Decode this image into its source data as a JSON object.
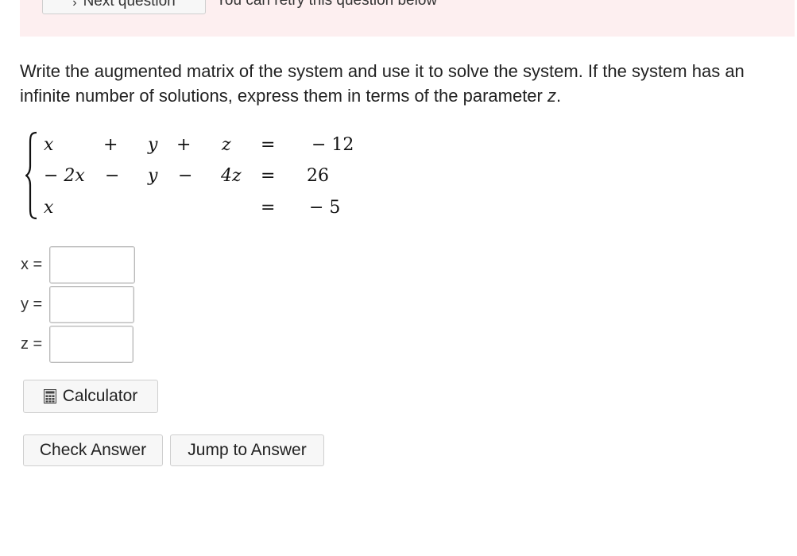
{
  "banner": {
    "next_question_label": "Next question",
    "next_question_icon": "chevron-right-icon",
    "retry_text": "You can retry this question below"
  },
  "question": {
    "text": "Write the augmented matrix of the system and use it to solve the system. If the system has an infinite number of solutions, express them in terms of the parameter ",
    "parameter": "z",
    "end": "."
  },
  "system": {
    "rows": [
      {
        "x": "x",
        "op1": "+",
        "y": "y",
        "op2": "+",
        "z": "z",
        "eq": "=",
        "rhs": "− 12"
      },
      {
        "x": "− 2x",
        "op1": "−",
        "y": "y",
        "op2": "−",
        "z": "4z",
        "eq": "=",
        "rhs": "26"
      },
      {
        "x": "x",
        "op1": "",
        "y": "",
        "op2": "",
        "z": "",
        "eq": "=",
        "rhs": "− 5"
      }
    ]
  },
  "answers": {
    "x_label": "x =",
    "y_label": "y =",
    "z_label": "z =",
    "x_value": "",
    "y_value": "",
    "z_value": ""
  },
  "buttons": {
    "calculator": "Calculator",
    "calculator_icon": "calculator-icon",
    "check_answer": "Check Answer",
    "jump_to_answer": "Jump to Answer"
  },
  "colors": {
    "banner_bg": "#fdeff0",
    "button_bg": "#f7f7f7",
    "button_border": "#cfcfcf"
  }
}
